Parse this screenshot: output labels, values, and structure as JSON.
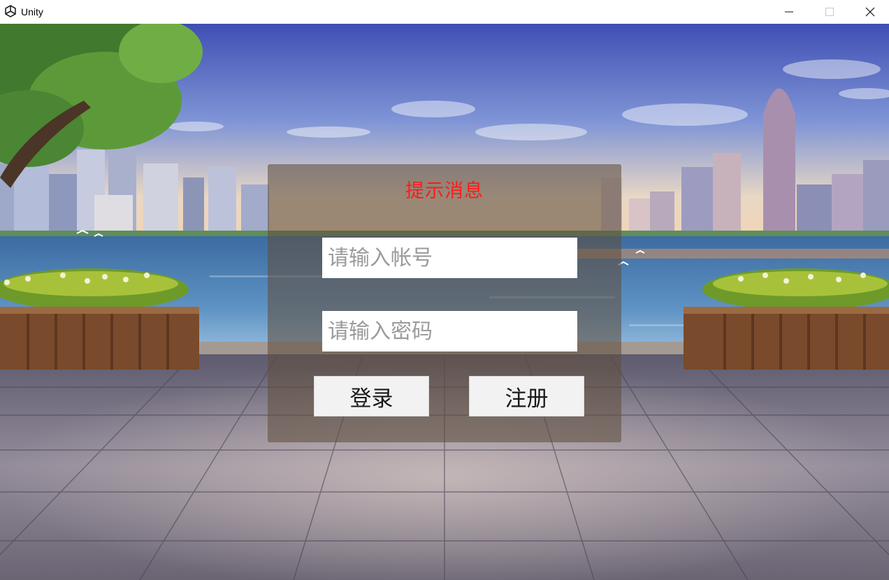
{
  "window": {
    "title": "Unity",
    "app_icon": "unity-logo-icon",
    "controls": [
      "minimize-icon",
      "maximize-icon",
      "close-icon"
    ]
  },
  "login_panel": {
    "title": "提示消息",
    "title_color": "#ff1a1a",
    "account_input": {
      "value": "",
      "placeholder": "请输入帐号"
    },
    "password_input": {
      "value": "",
      "placeholder": "请输入密码"
    },
    "login_button": "登录",
    "register_button": "注册"
  }
}
